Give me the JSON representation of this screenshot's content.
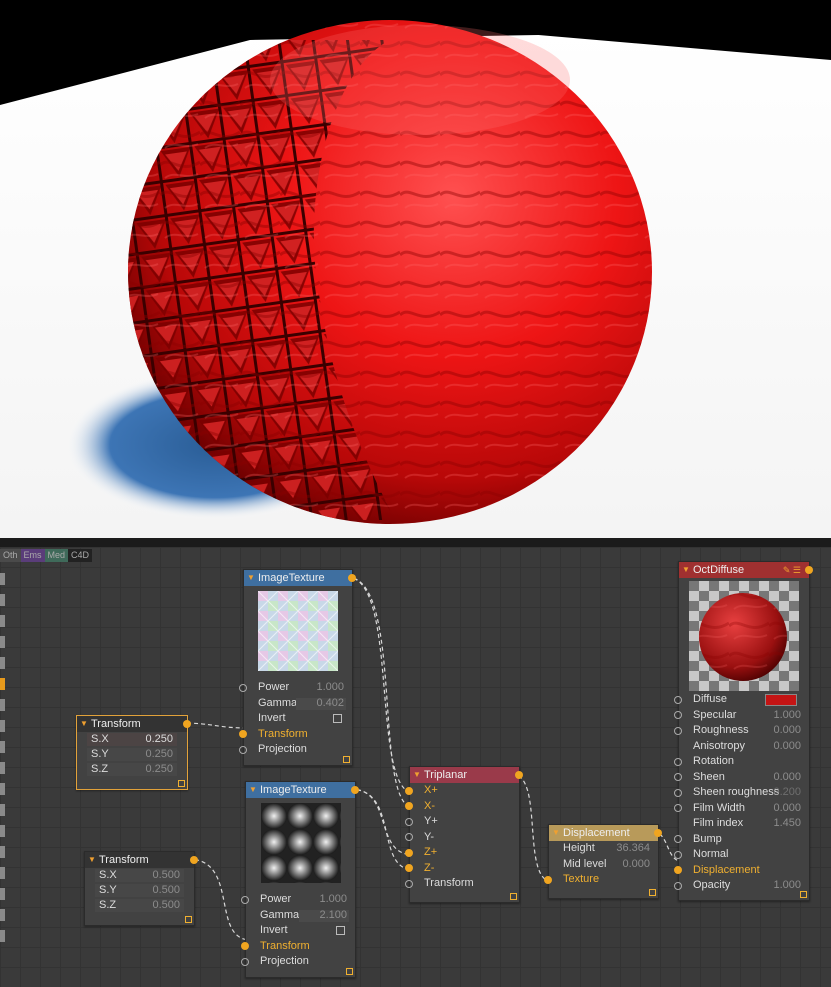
{
  "tabs": [
    "Oth",
    "Ems",
    "Med",
    "C4D"
  ],
  "tab_colors": [
    "#4a4a4a",
    "#5a3d7a",
    "#3f6a5a",
    "#222222"
  ],
  "nodes": {
    "img_top": {
      "title": "ImageTexture",
      "title_color": "#3f6fa0",
      "rows": [
        {
          "label": "Power",
          "value": "1.000"
        },
        {
          "label": "Gamma",
          "value": "0.402"
        },
        {
          "label": "Invert"
        },
        {
          "label": "Transform"
        },
        {
          "label": "Projection"
        }
      ]
    },
    "img_bottom": {
      "title": "ImageTexture",
      "title_color": "#3f6fa0",
      "rows": [
        {
          "label": "Power",
          "value": "1.000"
        },
        {
          "label": "Gamma",
          "value": "2.100"
        },
        {
          "label": "Invert"
        },
        {
          "label": "Transform"
        },
        {
          "label": "Projection"
        }
      ]
    },
    "transform_top": {
      "title": "Transform",
      "rows": [
        {
          "label": "S.X",
          "value": "0.250"
        },
        {
          "label": "S.Y",
          "value": "0.250"
        },
        {
          "label": "S.Z",
          "value": "0.250"
        }
      ]
    },
    "transform_bottom": {
      "title": "Transform",
      "rows": [
        {
          "label": "S.X",
          "value": "0.500"
        },
        {
          "label": "S.Y",
          "value": "0.500"
        },
        {
          "label": "S.Z",
          "value": "0.500"
        }
      ]
    },
    "triplanar": {
      "title": "Triplanar",
      "title_color": "#9a3a4a",
      "rows": [
        "X+",
        "X-",
        "Y+",
        "Y-",
        "Z+",
        "Z-",
        "Transform"
      ]
    },
    "displacement": {
      "title": "Displacement",
      "title_color": "#b89a5a",
      "rows": [
        {
          "label": "Height",
          "value": "36.364"
        },
        {
          "label": "Mid level",
          "value": "0.000"
        },
        {
          "label": "Texture"
        }
      ]
    },
    "octdiffuse": {
      "title": "OctDiffuse",
      "title_color": "#a03030",
      "rows": [
        {
          "label": "Diffuse",
          "value": ""
        },
        {
          "label": "Specular",
          "value": "1.000"
        },
        {
          "label": "Roughness",
          "value": "0.000"
        },
        {
          "label": "Anisotropy",
          "value": "0.000"
        },
        {
          "label": "Rotation",
          "value": ""
        },
        {
          "label": "Sheen",
          "value": "0.000"
        },
        {
          "label": "Sheen roughness",
          "value": "0.200"
        },
        {
          "label": "Film Width",
          "value": "0.000"
        },
        {
          "label": "Film index",
          "value": "1.450"
        },
        {
          "label": "Bump",
          "value": ""
        },
        {
          "label": "Normal",
          "value": ""
        },
        {
          "label": "Displacement",
          "value": ""
        },
        {
          "label": "Opacity",
          "value": "1.000"
        }
      ],
      "diffuse_color": "#c41414"
    }
  }
}
